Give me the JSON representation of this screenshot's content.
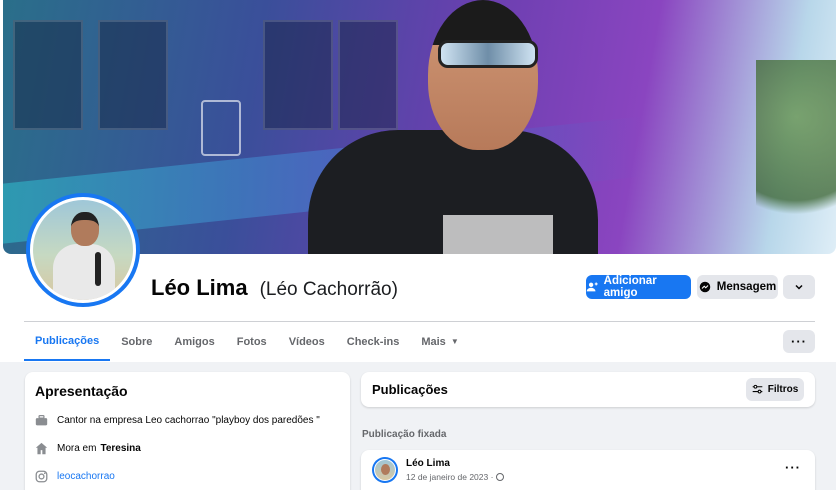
{
  "profile": {
    "name": "Léo Lima",
    "alternate_name": "(Léo Cachorrão)"
  },
  "actions": {
    "add_friend_label": "Adicionar amigo",
    "message_label": "Mensagem"
  },
  "tabs": [
    {
      "label": "Publicações",
      "active": true
    },
    {
      "label": "Sobre"
    },
    {
      "label": "Amigos"
    },
    {
      "label": "Fotos"
    },
    {
      "label": "Vídeos"
    },
    {
      "label": "Check-ins"
    },
    {
      "label": "Mais"
    }
  ],
  "intro": {
    "title": "Apresentação",
    "work": "Cantor na empresa Leo cachorrao \"playboy dos paredões \"",
    "lives_prefix": "Mora em",
    "lives_city": "Teresina",
    "instagram": "leocachorrao"
  },
  "posts": {
    "title": "Publicações",
    "filters_label": "Filtros",
    "pinned_label": "Publicação fixada",
    "pinned_post": {
      "author": "Léo Lima",
      "date": "12 de janeiro de 2023 ·"
    }
  },
  "colors": {
    "accent": "#1877f2",
    "page_bg": "#f0f2f5",
    "secondary_button": "#e4e6eb"
  }
}
